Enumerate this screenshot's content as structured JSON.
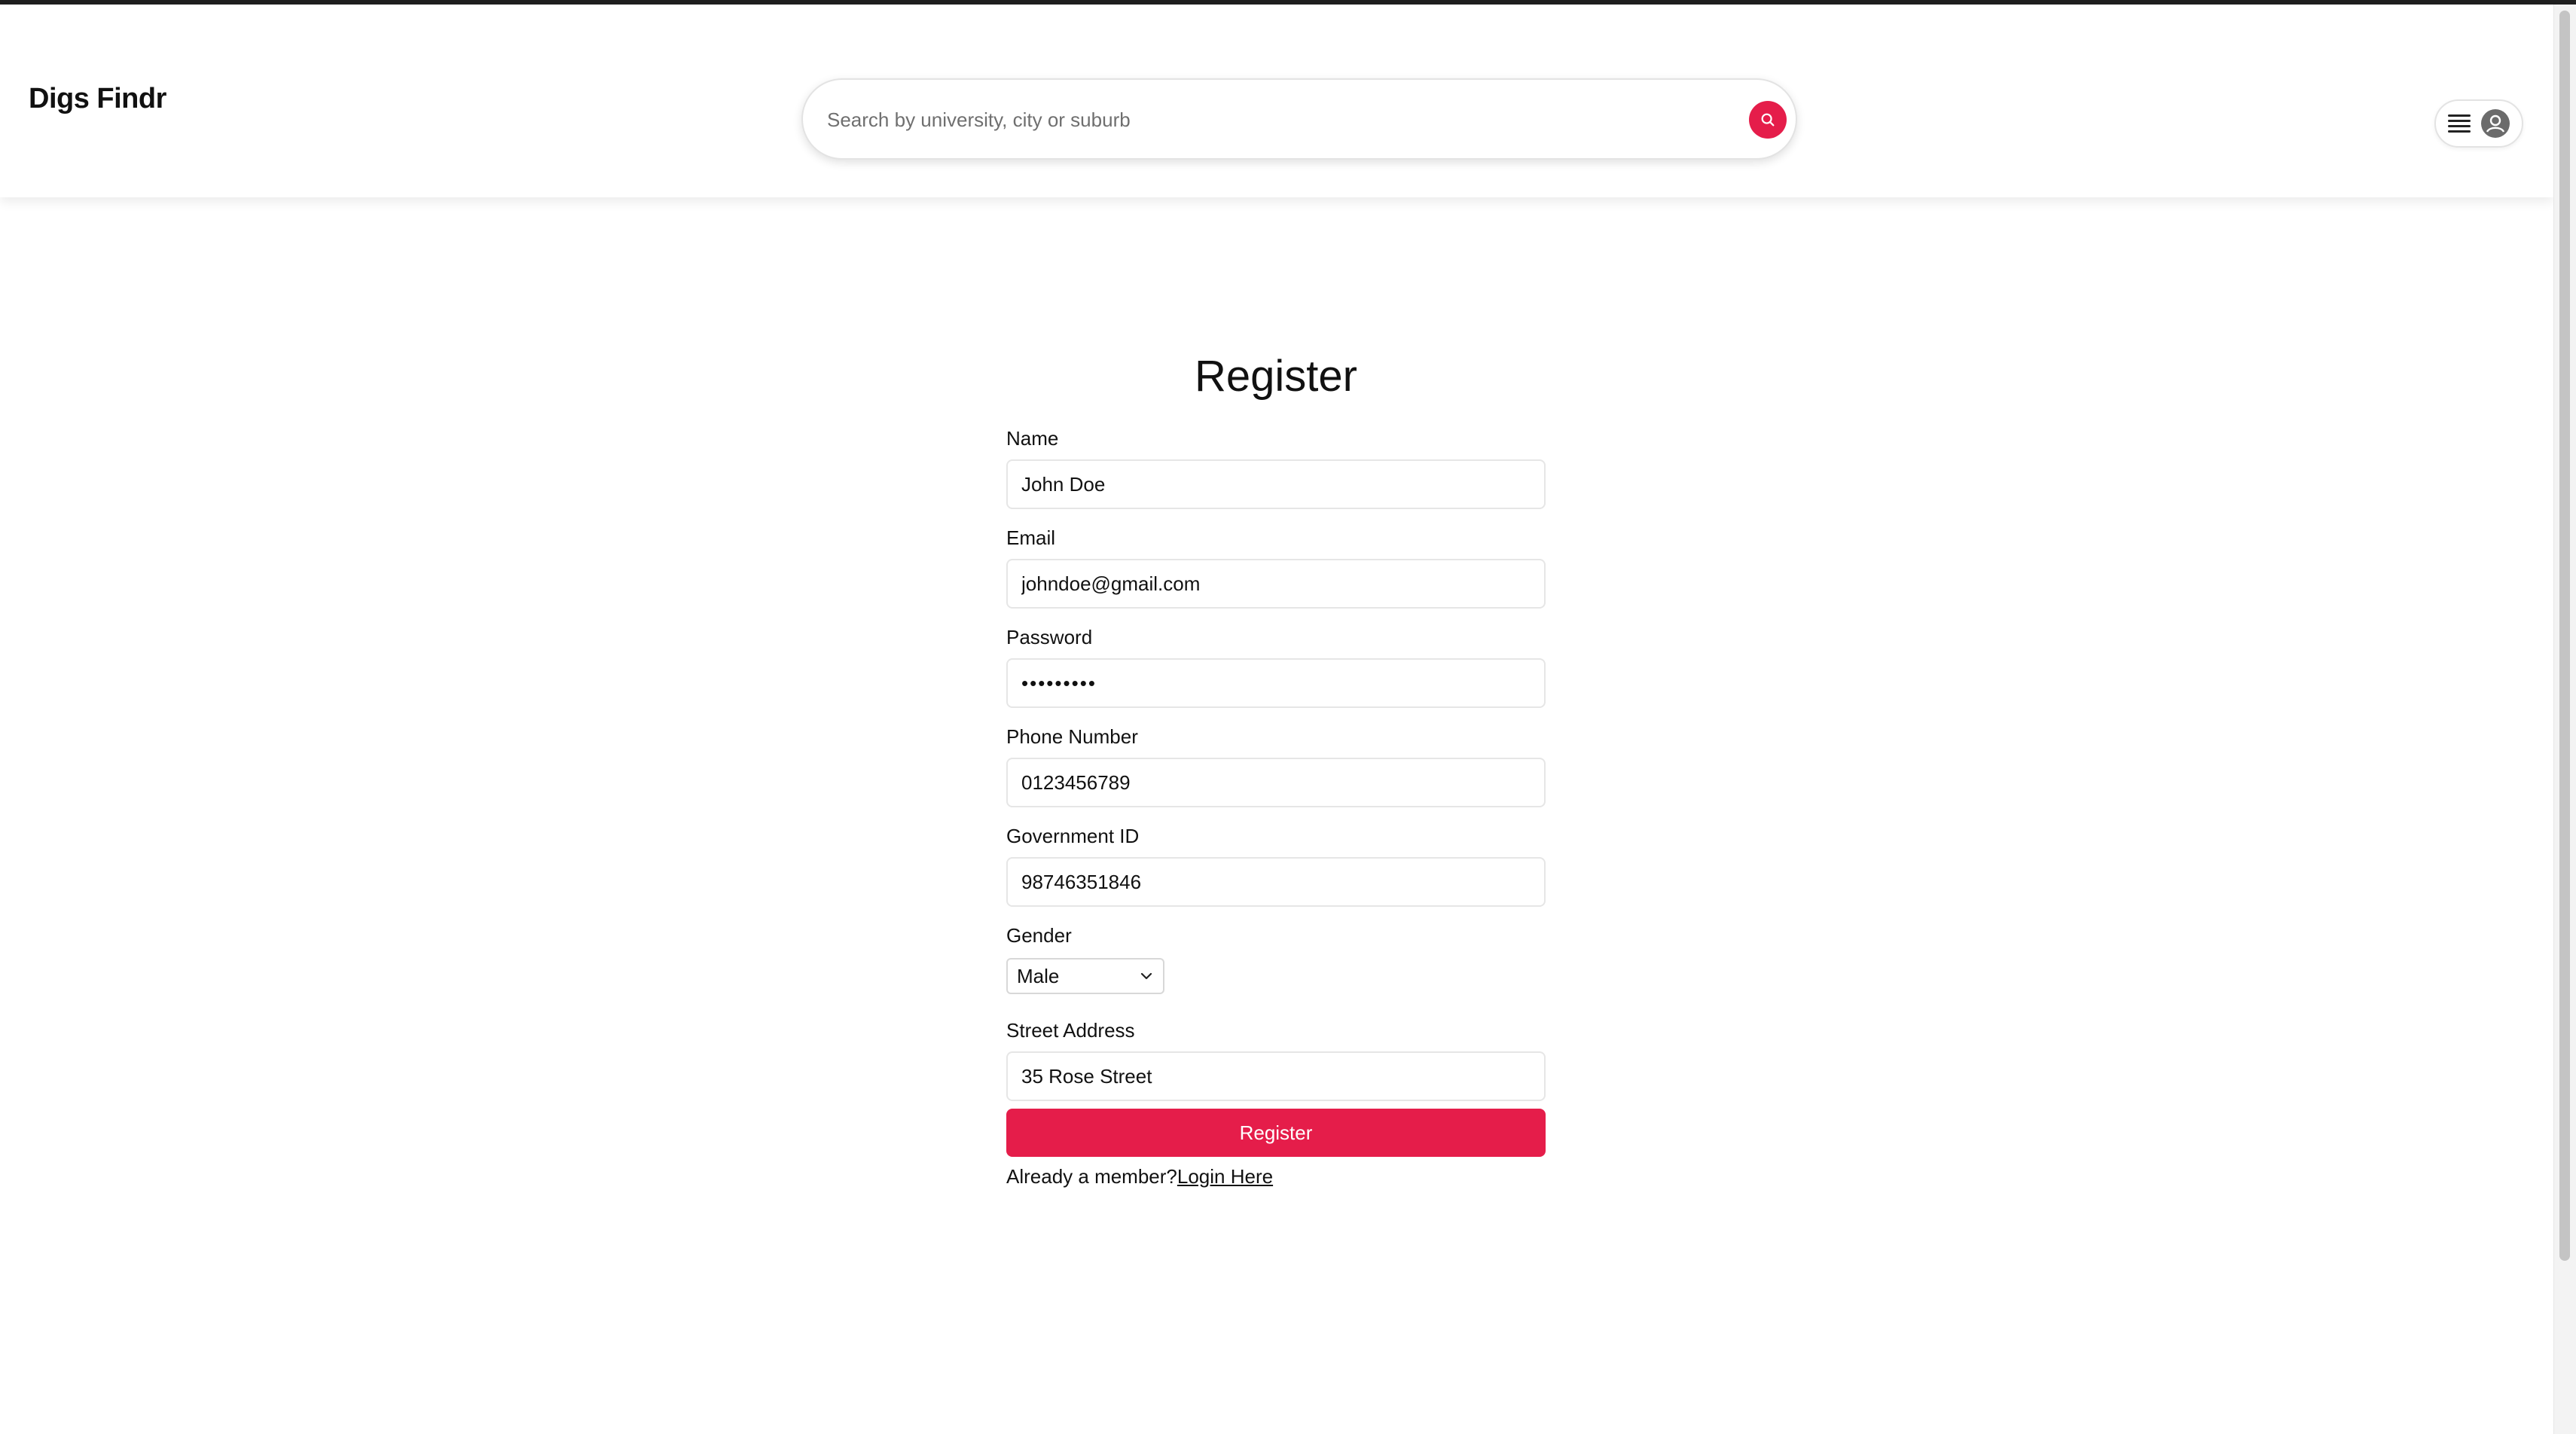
{
  "header": {
    "brand": "Digs Findr",
    "search_placeholder": "Search by university, city or suburb",
    "search_icon": "search-icon",
    "menu_icon": "hamburger-menu-icon",
    "avatar_icon": "user-avatar-icon"
  },
  "form": {
    "title": "Register",
    "fields": {
      "name": {
        "label": "Name",
        "value": "John Doe"
      },
      "email": {
        "label": "Email",
        "value": "johndoe@gmail.com"
      },
      "password": {
        "label": "Password",
        "value": "•••••••••"
      },
      "phone": {
        "label": "Phone Number",
        "value": "0123456789"
      },
      "government_id": {
        "label": "Government ID",
        "value": "98746351846"
      },
      "gender": {
        "label": "Gender",
        "value": "Male"
      },
      "street": {
        "label": "Street Address",
        "value": "35 Rose Street"
      }
    },
    "submit_label": "Register",
    "member_prompt": "Already a member?",
    "login_link": "Login Here"
  },
  "colors": {
    "accent": "#e51d4a"
  }
}
